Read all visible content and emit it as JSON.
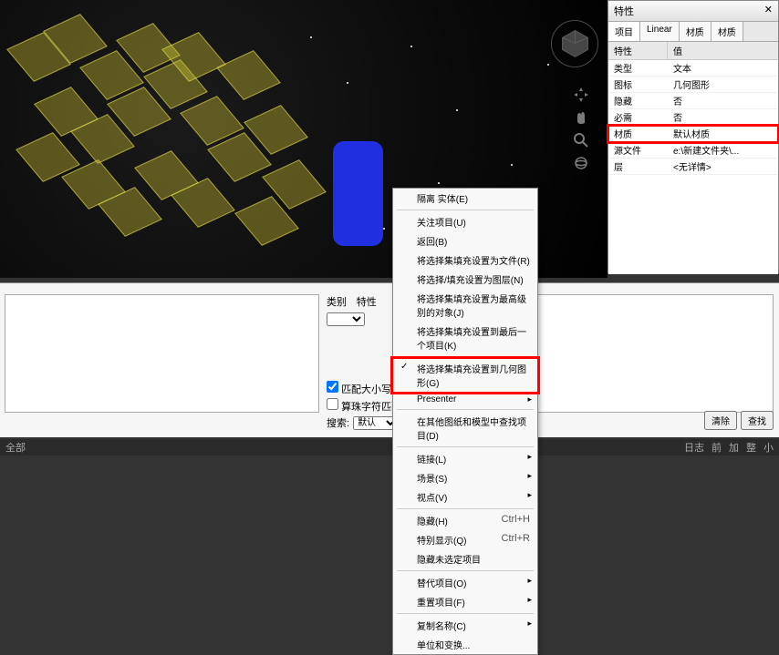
{
  "props_panel": {
    "title": "特性",
    "tabs": [
      "项目",
      "Linear",
      "材质",
      "材质"
    ],
    "active_tab": 0,
    "header": {
      "col1": "特性",
      "col2": "值"
    },
    "rows": [
      {
        "k": "类型",
        "v": "文本",
        "hl": false
      },
      {
        "k": "图标",
        "v": "几何图形",
        "hl": false
      },
      {
        "k": "隐藏",
        "v": "否",
        "hl": false
      },
      {
        "k": "必需",
        "v": "否",
        "hl": false
      },
      {
        "k": "材质",
        "v": "默认材质",
        "hl": true
      },
      {
        "k": "源文件",
        "v": "e:\\新建文件夹\\...",
        "hl": false
      },
      {
        "k": "层",
        "v": "<无详情>",
        "hl": false
      }
    ]
  },
  "context_menu": {
    "items": [
      {
        "label": "隔离 实体(E)",
        "type": "item"
      },
      {
        "type": "sep"
      },
      {
        "label": "关注项目(U)",
        "type": "item"
      },
      {
        "label": "返回(B)",
        "type": "item"
      },
      {
        "label": "将选择集填充设置为文件(R)",
        "type": "item"
      },
      {
        "label": "将选择/填充设置为图层(N)",
        "type": "item"
      },
      {
        "label": "将选择集填充设置为最高级别的对象(J)",
        "type": "item"
      },
      {
        "label": "将选择集填充设置到最后一个项目(K)",
        "type": "item"
      },
      {
        "type": "sep"
      },
      {
        "label": "将选择集填充设置到几何图形(G)",
        "type": "item",
        "checked": true,
        "hl": true
      },
      {
        "label": "Presenter",
        "type": "sub"
      },
      {
        "type": "sep"
      },
      {
        "label": "在其他图纸和模型中查找项目(D)",
        "type": "item"
      },
      {
        "type": "sep"
      },
      {
        "label": "链接(L)",
        "type": "sub"
      },
      {
        "label": "场景(S)",
        "type": "sub"
      },
      {
        "label": "视点(V)",
        "type": "sub"
      },
      {
        "type": "sep"
      },
      {
        "label": "隐藏(H)",
        "type": "item",
        "shortcut": "Ctrl+H"
      },
      {
        "label": "特别显示(Q)",
        "type": "item",
        "shortcut": "Ctrl+R"
      },
      {
        "label": "隐藏未选定项目",
        "type": "item"
      },
      {
        "type": "sep"
      },
      {
        "label": "替代项目(O)",
        "type": "sub"
      },
      {
        "label": "重置项目(F)",
        "type": "sub"
      },
      {
        "type": "sep"
      },
      {
        "label": "复制名称(C)",
        "type": "sub"
      },
      {
        "label": "单位和变换...",
        "type": "item"
      }
    ]
  },
  "bottom_panel": {
    "mid_label1": "类别",
    "mid_label2": "特性",
    "chk1": "匹配大小写",
    "chk2": "算珠字符匹配结果",
    "search_label": "搜索:",
    "search_dropdown": "默认",
    "btn_clear": "清除",
    "btn_find": "查找"
  },
  "statusbar": {
    "left": "全部",
    "right_items": [
      "日志",
      "前",
      "加",
      "整",
      "小"
    ]
  }
}
